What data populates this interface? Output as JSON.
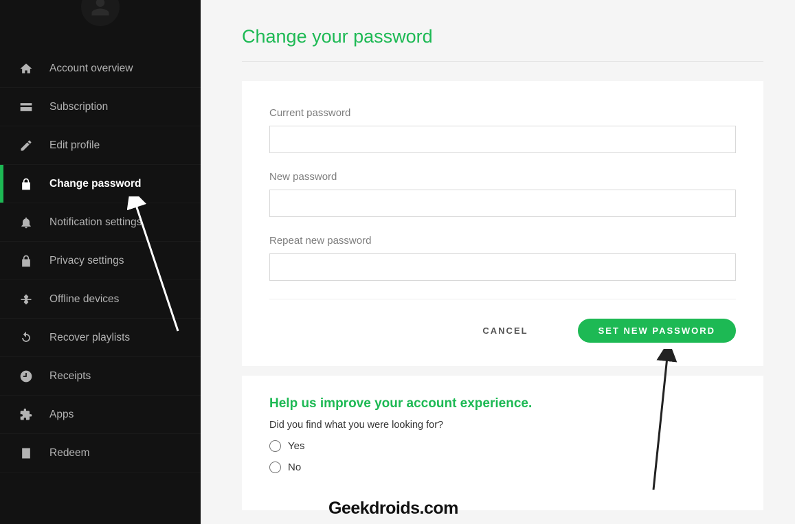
{
  "colors": {
    "accent": "#1db954"
  },
  "sidebar": {
    "items": [
      {
        "id": "account-overview",
        "label": "Account overview",
        "icon": "home-icon",
        "active": false
      },
      {
        "id": "subscription",
        "label": "Subscription",
        "icon": "card-icon",
        "active": false
      },
      {
        "id": "edit-profile",
        "label": "Edit profile",
        "icon": "pencil-icon",
        "active": false
      },
      {
        "id": "change-password",
        "label": "Change password",
        "icon": "lock-icon",
        "active": true
      },
      {
        "id": "notification-settings",
        "label": "Notification settings",
        "icon": "bell-icon",
        "active": false
      },
      {
        "id": "privacy-settings",
        "label": "Privacy settings",
        "icon": "lock-icon",
        "active": false
      },
      {
        "id": "offline-devices",
        "label": "Offline devices",
        "icon": "offline-icon",
        "active": false
      },
      {
        "id": "recover-playlists",
        "label": "Recover playlists",
        "icon": "refresh-icon",
        "active": false
      },
      {
        "id": "receipts",
        "label": "Receipts",
        "icon": "clock-icon",
        "active": false
      },
      {
        "id": "apps",
        "label": "Apps",
        "icon": "puzzle-icon",
        "active": false
      },
      {
        "id": "redeem",
        "label": "Redeem",
        "icon": "redeem-icon",
        "active": false
      }
    ]
  },
  "main": {
    "title": "Change your password",
    "form": {
      "current_label": "Current password",
      "new_label": "New password",
      "repeat_label": "Repeat new password",
      "current_value": "",
      "new_value": "",
      "repeat_value": ""
    },
    "actions": {
      "cancel": "CANCEL",
      "submit": "SET NEW PASSWORD"
    },
    "feedback": {
      "title": "Help us improve your account experience.",
      "question": "Did you find what you were looking for?",
      "option_yes": "Yes",
      "option_no": "No"
    }
  },
  "watermark": "Geekdroids.com"
}
